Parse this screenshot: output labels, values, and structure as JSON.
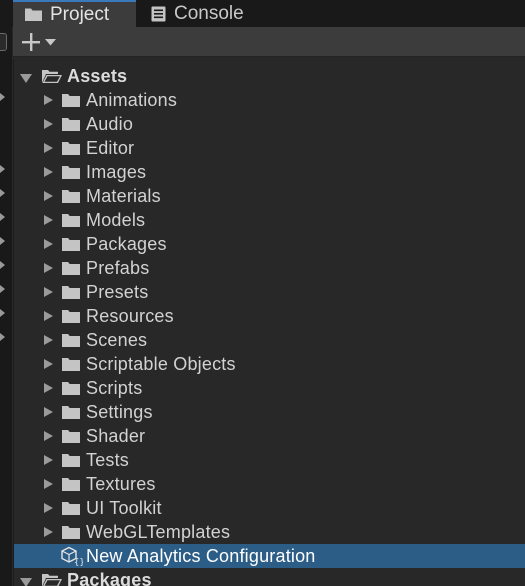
{
  "tabs": [
    {
      "label": "Project",
      "icon": "folder-icon",
      "active": true
    },
    {
      "label": "Console",
      "icon": "console-icon",
      "active": false
    }
  ],
  "toolbar": {
    "add_icon": "plus-icon",
    "dropdown_icon": "chevron-down-icon"
  },
  "tree": {
    "root": {
      "label": "Assets",
      "expanded": true
    },
    "folders": [
      {
        "label": "Animations"
      },
      {
        "label": "Audio"
      },
      {
        "label": "Editor"
      },
      {
        "label": "Images"
      },
      {
        "label": "Materials"
      },
      {
        "label": "Models"
      },
      {
        "label": "Packages"
      },
      {
        "label": "Prefabs"
      },
      {
        "label": "Presets"
      },
      {
        "label": "Resources"
      },
      {
        "label": "Scenes"
      },
      {
        "label": "Scriptable Objects"
      },
      {
        "label": "Scripts"
      },
      {
        "label": "Settings"
      },
      {
        "label": "Shader"
      },
      {
        "label": "Tests"
      },
      {
        "label": "Textures"
      },
      {
        "label": "UI Toolkit"
      },
      {
        "label": "WebGLTemplates"
      }
    ],
    "selected_asset": {
      "label": "New Analytics Configuration",
      "icon": "scriptable-object-icon"
    },
    "second_root": {
      "label": "Packages",
      "expanded": true
    }
  },
  "colors": {
    "selection": "#2c5d87",
    "tab_accent": "#3a79bb",
    "panel_bg": "#282828",
    "toolbar_bg": "#3c3c3c"
  }
}
